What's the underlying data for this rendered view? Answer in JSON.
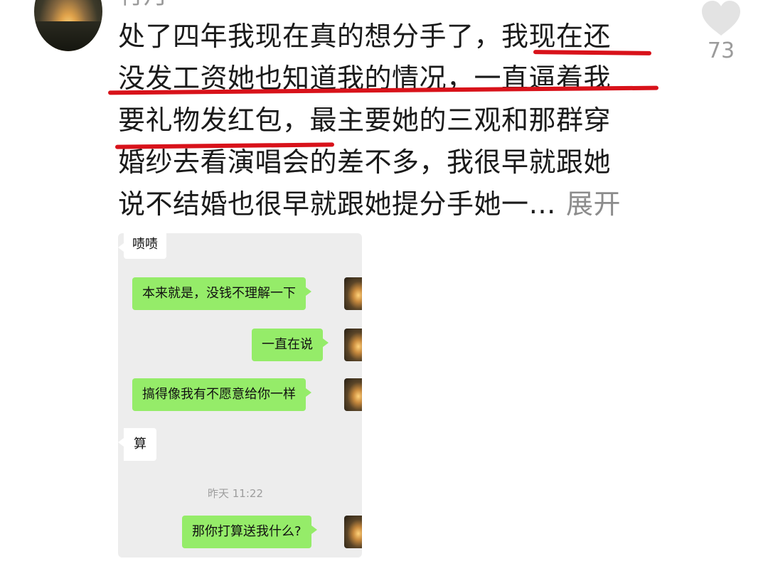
{
  "comment": {
    "username": "行月",
    "lines": [
      "处了四年我现在真的想分手了，我现在还",
      "没发工资她也知道我的情况，一直逼着我",
      "要礼物发红包，最主要她的三观和那群穿",
      "婚纱去看演唱会的差不多，我很早就跟她",
      "说不结婚也很早就跟她提分手她一…"
    ],
    "expand_label": "展开",
    "like_count": "73",
    "like_icon": "heart-icon"
  },
  "chat_screenshot": {
    "messages": [
      {
        "side": "left",
        "text": "啧啧"
      },
      {
        "side": "right",
        "text": "本来就是，没钱不理解一下"
      },
      {
        "side": "right",
        "text": "一直在说"
      },
      {
        "side": "right",
        "text": "搞得像我有不愿意给你一样"
      },
      {
        "side": "left",
        "text": "算"
      },
      {
        "side": "right",
        "text": "那你打算送我什么?"
      }
    ],
    "timestamp": "昨天 11:22"
  },
  "colors": {
    "underline": "#d8121a",
    "bubble_right": "#95ec69",
    "bubble_left": "#ffffff",
    "chat_background": "#ededed",
    "secondary_text": "#9b9b9b"
  }
}
